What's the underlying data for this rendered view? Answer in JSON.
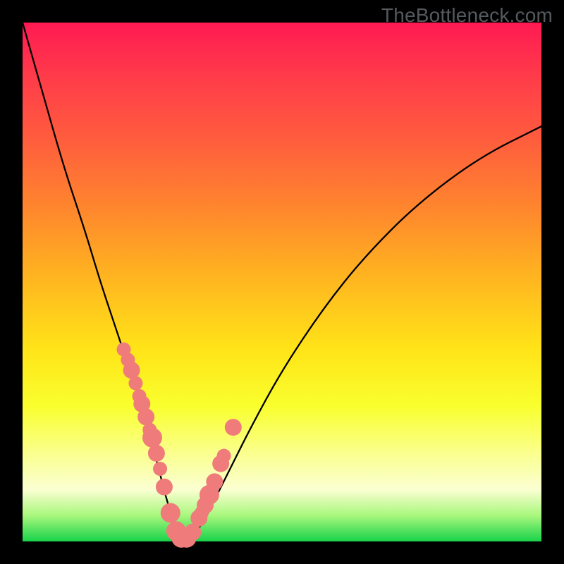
{
  "watermark": "TheBottleneck.com",
  "chart_data": {
    "type": "line",
    "title": "",
    "xlabel": "",
    "ylabel": "",
    "xlim": [
      0,
      100
    ],
    "ylim": [
      0,
      100
    ],
    "grid": false,
    "legend": false,
    "gradient_stops": [
      {
        "pct": 0,
        "color": "#ff1a52"
      },
      {
        "pct": 10,
        "color": "#ff3a4a"
      },
      {
        "pct": 22,
        "color": "#ff5b3e"
      },
      {
        "pct": 37,
        "color": "#ff8a2c"
      },
      {
        "pct": 50,
        "color": "#ffb81f"
      },
      {
        "pct": 63,
        "color": "#ffe418"
      },
      {
        "pct": 74,
        "color": "#f9ff2e"
      },
      {
        "pct": 83,
        "color": "#faff8e"
      },
      {
        "pct": 90,
        "color": "#fbffd2"
      },
      {
        "pct": 95,
        "color": "#a8f77d"
      },
      {
        "pct": 100,
        "color": "#18d24a"
      }
    ],
    "series": [
      {
        "name": "v-curve",
        "x": [
          0,
          4,
          8,
          12,
          15,
          18,
          20,
          22,
          24,
          26,
          27.5,
          29,
          30,
          31,
          32,
          33,
          35,
          37,
          40,
          44,
          50,
          58,
          66,
          76,
          88,
          100
        ],
        "values": [
          100,
          86,
          72,
          60,
          50,
          41,
          35,
          29,
          22,
          15,
          9,
          4,
          1.5,
          0.5,
          0.5,
          1.2,
          4,
          8,
          14,
          22,
          33,
          45,
          55,
          65,
          74,
          80
        ]
      }
    ],
    "markers": {
      "name": "pink-beads",
      "x": [
        19.5,
        20.3,
        21.0,
        21.8,
        22.5,
        23.0,
        23.8,
        24.5,
        25.0,
        25.8,
        26.5,
        27.3,
        28.5,
        29.6,
        30.6,
        31.6,
        32.8,
        34.0,
        34.5,
        35.2,
        36.0,
        37.0,
        38.2,
        38.8,
        40.6
      ],
      "y": [
        37.0,
        35.0,
        33.0,
        30.5,
        28.0,
        26.5,
        24.0,
        21.5,
        20.0,
        17.0,
        14.0,
        10.5,
        5.5,
        2.0,
        0.7,
        0.7,
        1.8,
        4.5,
        5.5,
        7.0,
        9.0,
        11.5,
        15.0,
        16.5,
        22.0
      ],
      "r": [
        10,
        10,
        12,
        10,
        10,
        12,
        12,
        10,
        14,
        12,
        10,
        12,
        14,
        14,
        14,
        14,
        12,
        12,
        10,
        12,
        14,
        12,
        12,
        10,
        12
      ]
    }
  }
}
